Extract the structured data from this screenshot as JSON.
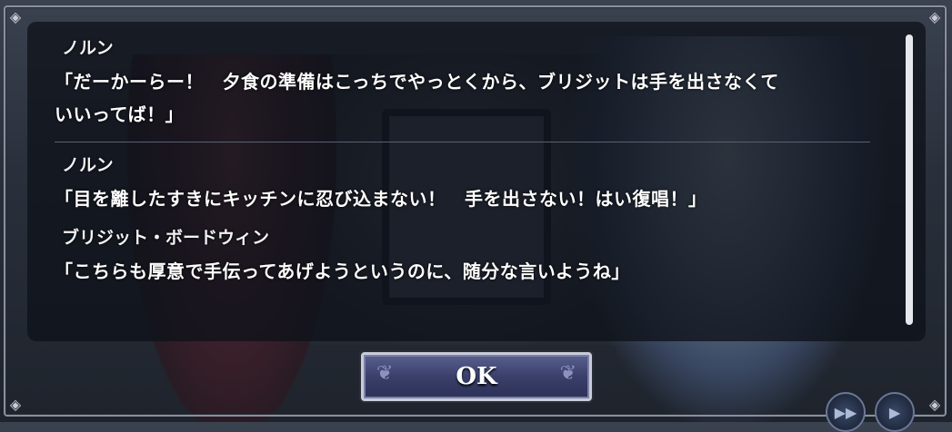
{
  "dialog": {
    "entries": [
      {
        "speaker": "ノルン",
        "text": "「だーかーらー！　夕食の準備はこっちでやっとくから、ブリジットは手を出さなくて",
        "text2": "いいってば！」"
      },
      {
        "speaker": "ノルン",
        "text": "「目を離したすきにキッチンに忍び込まない！　手を出さない！はい復唱！」"
      },
      {
        "speaker": "ブリジット・ボードウィン",
        "text": "「こちらも厚意で手伝ってあげようというのに、随分な言いようね」"
      }
    ]
  },
  "ok_button": {
    "label": "OK"
  },
  "controls": {
    "skip_icon": "fast-forward-icon",
    "auto_icon": "play-icon"
  },
  "colors": {
    "panel_bg": "#0e121a",
    "button_bg": "#3a3f6a",
    "text": "#ffffff"
  }
}
